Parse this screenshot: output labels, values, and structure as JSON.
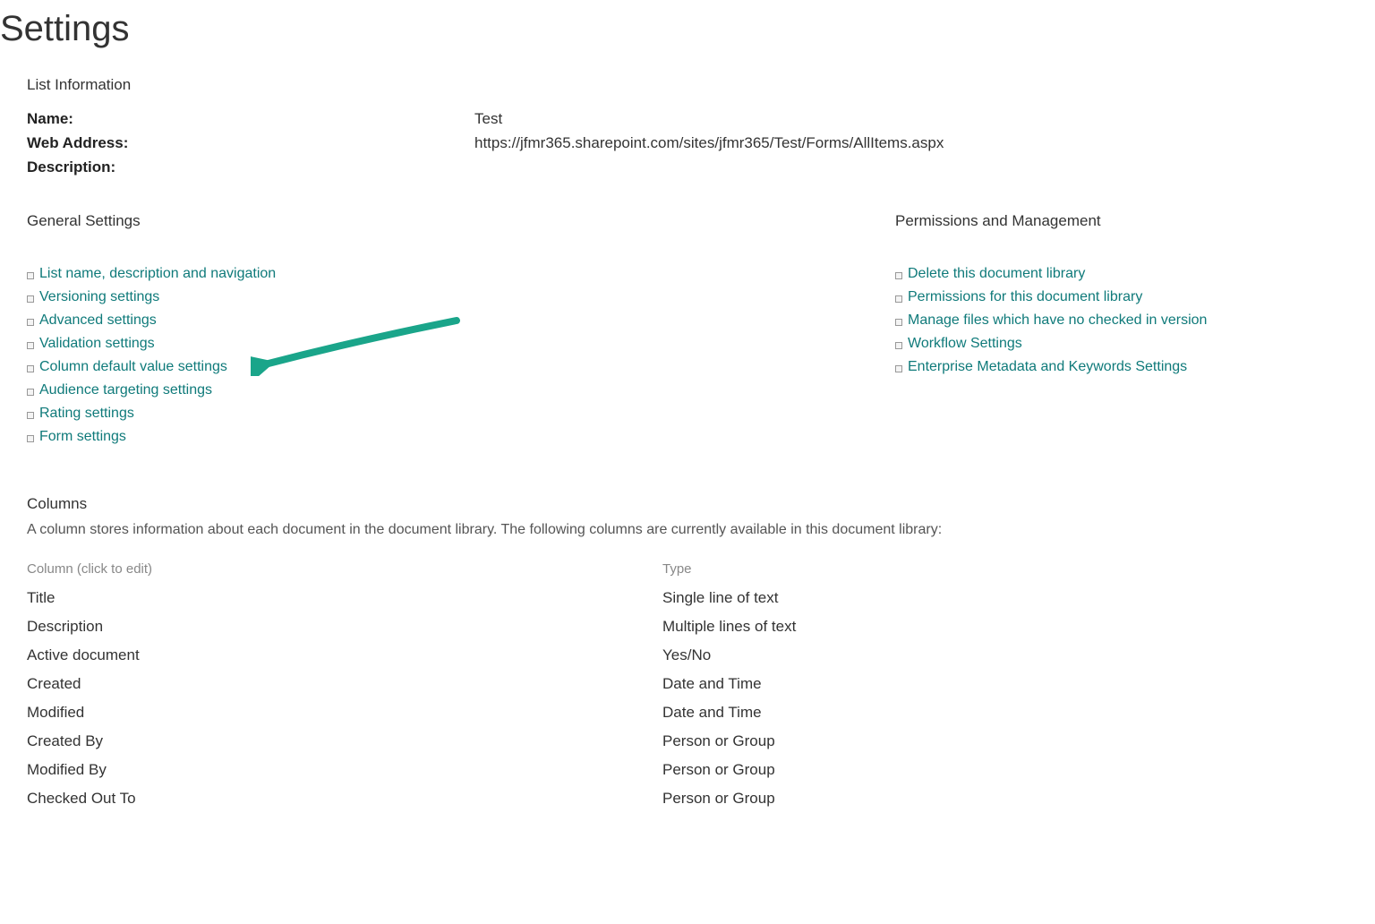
{
  "page_title": "Settings",
  "list_info": {
    "heading": "List Information",
    "labels": {
      "name": "Name:",
      "web": "Web Address:",
      "desc": "Description:"
    },
    "values": {
      "name": "Test",
      "web": "https://jfmr365.sharepoint.com/sites/jfmr365/Test/Forms/AllItems.aspx",
      "desc": ""
    }
  },
  "general": {
    "heading": "General Settings",
    "links": [
      "List name, description and navigation",
      "Versioning settings",
      "Advanced settings",
      "Validation settings",
      "Column default value settings",
      "Audience targeting settings",
      "Rating settings",
      "Form settings"
    ]
  },
  "permissions": {
    "heading": "Permissions and Management",
    "links": [
      "Delete this document library",
      "Permissions for this document library",
      "Manage files which have no checked in version",
      "Workflow Settings",
      "Enterprise Metadata and Keywords Settings"
    ]
  },
  "columns": {
    "heading": "Columns",
    "description": "A column stores information about each document in the document library. The following columns are currently available in this document library:",
    "header_name": "Column (click to edit)",
    "header_type": "Type",
    "rows": [
      {
        "name": "Title",
        "type": "Single line of text"
      },
      {
        "name": "Description",
        "type": "Multiple lines of text"
      },
      {
        "name": "Active document",
        "type": "Yes/No"
      },
      {
        "name": "Created",
        "type": "Date and Time"
      },
      {
        "name": "Modified",
        "type": "Date and Time"
      },
      {
        "name": "Created By",
        "type": "Person or Group"
      },
      {
        "name": "Modified By",
        "type": "Person or Group"
      },
      {
        "name": "Checked Out To",
        "type": "Person or Group"
      }
    ]
  },
  "annotation": {
    "color": "#1aa58a"
  }
}
